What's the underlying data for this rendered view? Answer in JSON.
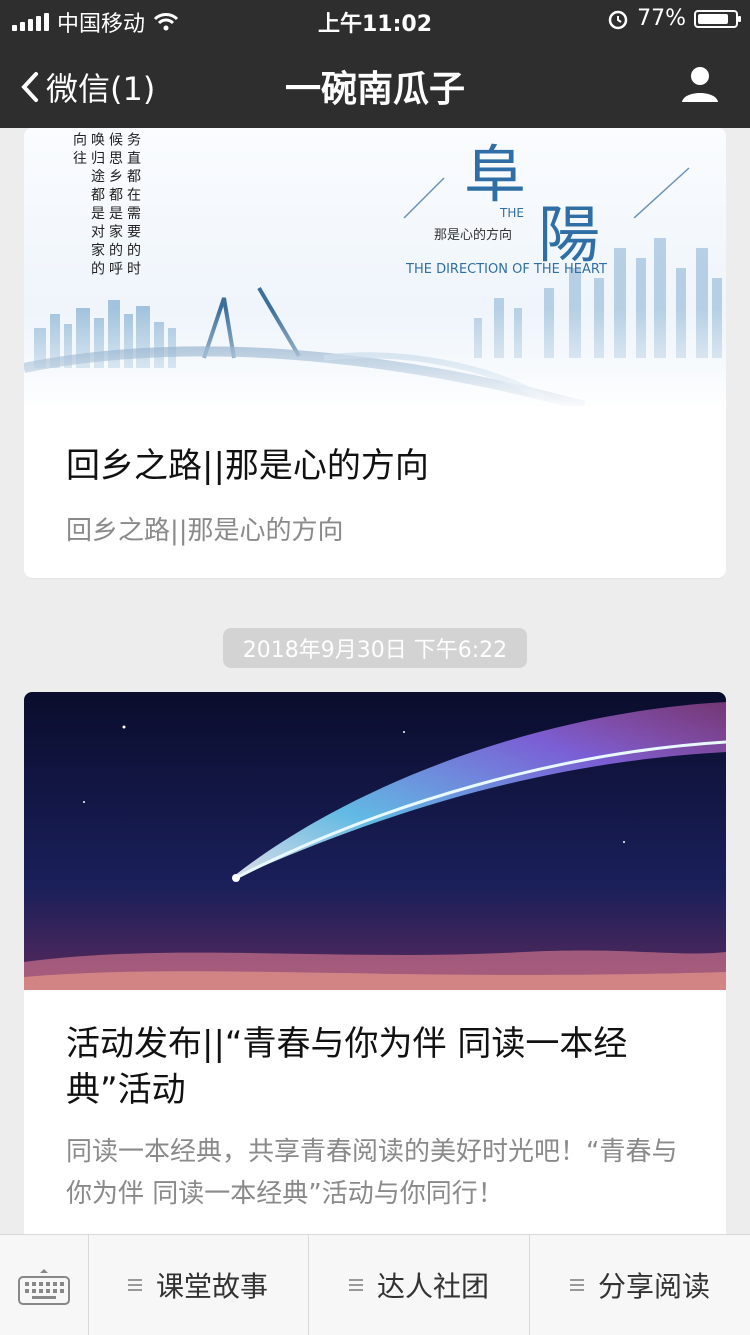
{
  "status_bar": {
    "carrier": "中国移动",
    "time": "上午11:02",
    "battery": "77%"
  },
  "nav": {
    "back_label": "微信(1)",
    "title": "一碗南瓜子",
    "user_icon": "user-icon"
  },
  "articles": [
    {
      "title": "回乡之路||那是心的方向",
      "desc": "回乡之路||那是心的方向",
      "cover_text": {
        "vertical_poem": "务 直 都 在 需 要 的 时 候 思 乡 都 是 家 的 呼 唤 归 途 都 是 对 家 的 向 往",
        "logo_top": "阜",
        "logo_bottom": "陽",
        "logo_the": "THE",
        "logo_sub": "那是心的方向",
        "logo_en": "THE DIRECTION OF THE HEART"
      }
    },
    {
      "timestamp": "2018年9月30日 下午6:22",
      "title": "活动发布||“青春与你为伴 同读一本经典”活动",
      "desc": "同读一本经典，共享青春阅读的美好时光吧！“青春与你为伴 同读一本经典”活动与你同行！"
    }
  ],
  "bottom_menu": {
    "keyboard_icon": "keyboard-icon",
    "items": [
      {
        "label": "课堂故事"
      },
      {
        "label": "达人社团"
      },
      {
        "label": "分享阅读"
      }
    ]
  },
  "colors": {
    "header_bg": "#2e2e2e",
    "page_bg": "#ededed",
    "card_bg": "#ffffff"
  }
}
